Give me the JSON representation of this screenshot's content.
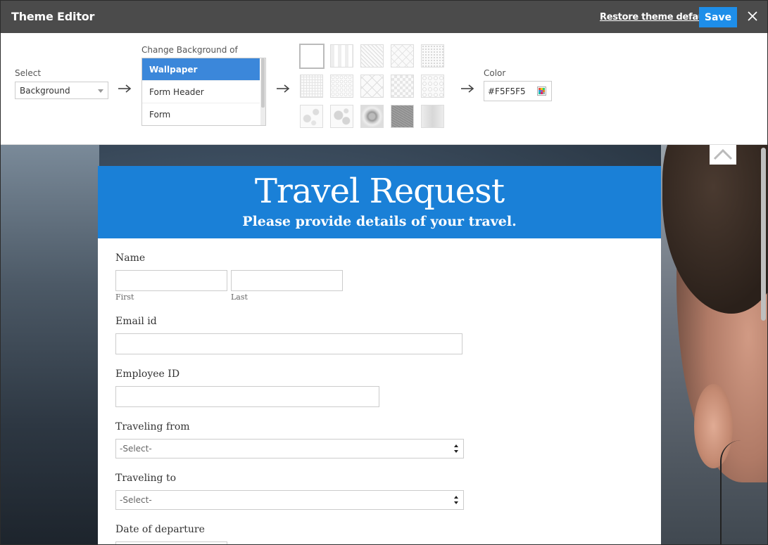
{
  "titlebar": {
    "title": "Theme Editor",
    "restore_label": "Restore theme defaults",
    "save_label": "Save"
  },
  "panel": {
    "select_label": "Select",
    "select_value": "Background",
    "change_bg_label": "Change Background of",
    "list_items": [
      {
        "label": "Wallpaper",
        "selected": true
      },
      {
        "label": "Form Header",
        "selected": false
      },
      {
        "label": "Form",
        "selected": false
      }
    ],
    "color_label": "Color",
    "color_value": "#F5F5F5"
  },
  "swatches": [
    {
      "name": "plain"
    },
    {
      "name": "vertical-stripes"
    },
    {
      "name": "diagonal-lines"
    },
    {
      "name": "diamond-grid"
    },
    {
      "name": "fine-dots"
    },
    {
      "name": "fine-grid"
    },
    {
      "name": "dot-grid"
    },
    {
      "name": "diamond-lattice"
    },
    {
      "name": "checkerboard"
    },
    {
      "name": "circle-dots"
    },
    {
      "name": "splatter"
    },
    {
      "name": "flowers"
    },
    {
      "name": "floral-dark"
    },
    {
      "name": "noise"
    },
    {
      "name": "gradient-gray"
    }
  ],
  "form": {
    "title": "Travel Request",
    "subtitle": "Please provide details of your travel.",
    "name_label": "Name",
    "first_label": "First",
    "last_label": "Last",
    "email_label": "Email id",
    "employee_label": "Employee ID",
    "from_label": "Traveling from",
    "from_value": "-Select-",
    "to_label": "Traveling to",
    "to_value": "-Select-",
    "departure_label": "Date of departure"
  },
  "colors": {
    "titlebar": "#4b4b4b",
    "accent": "#1e8ee9",
    "form_header": "#1a80d7",
    "list_selected": "#3b87da"
  }
}
